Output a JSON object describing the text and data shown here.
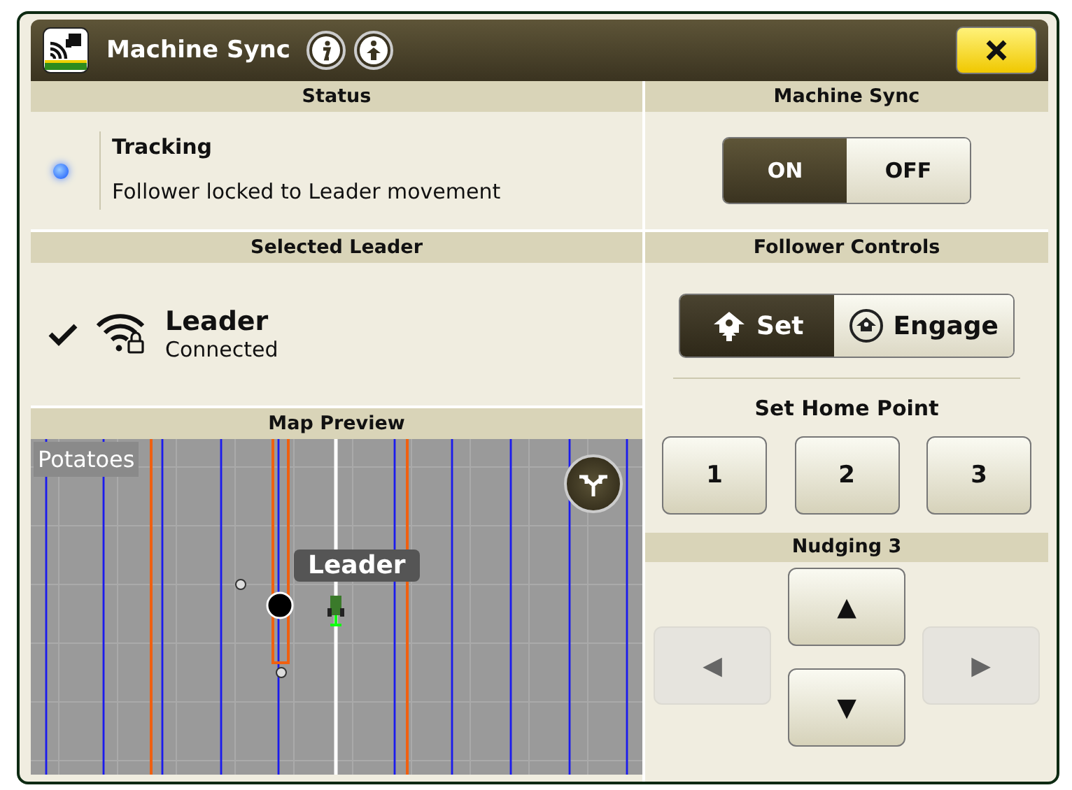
{
  "window": {
    "title": "Machine Sync"
  },
  "status": {
    "header": "Status",
    "indicator_on": true,
    "state": "Tracking",
    "message": "Follower locked to Leader movement"
  },
  "machine_sync": {
    "header": "Machine Sync",
    "options": [
      {
        "label": "ON",
        "selected": true
      },
      {
        "label": "OFF",
        "selected": false
      }
    ]
  },
  "selected_leader": {
    "header": "Selected Leader",
    "items": [
      {
        "name": "Leader",
        "status": "Connected",
        "checked": true
      }
    ]
  },
  "map_preview": {
    "header": "Map Preview",
    "field_label": "Potatoes",
    "vehicle_label": "Leader"
  },
  "follower_controls": {
    "header": "Follower Controls",
    "modes": [
      {
        "kind": "set",
        "label": "Set",
        "selected": true
      },
      {
        "kind": "engage",
        "label": "Engage",
        "selected": false
      }
    ],
    "home_point_title": "Set Home Point",
    "home_points": [
      "1",
      "2",
      "3"
    ]
  },
  "nudging": {
    "header": "Nudging 3",
    "buttons": [
      {
        "kind": "up",
        "glyph": "▲",
        "disabled": false
      },
      {
        "kind": "left",
        "glyph": "◀",
        "disabled": true
      },
      {
        "kind": "right",
        "glyph": "▶",
        "disabled": true
      },
      {
        "kind": "down",
        "glyph": "▼",
        "disabled": false
      }
    ]
  }
}
